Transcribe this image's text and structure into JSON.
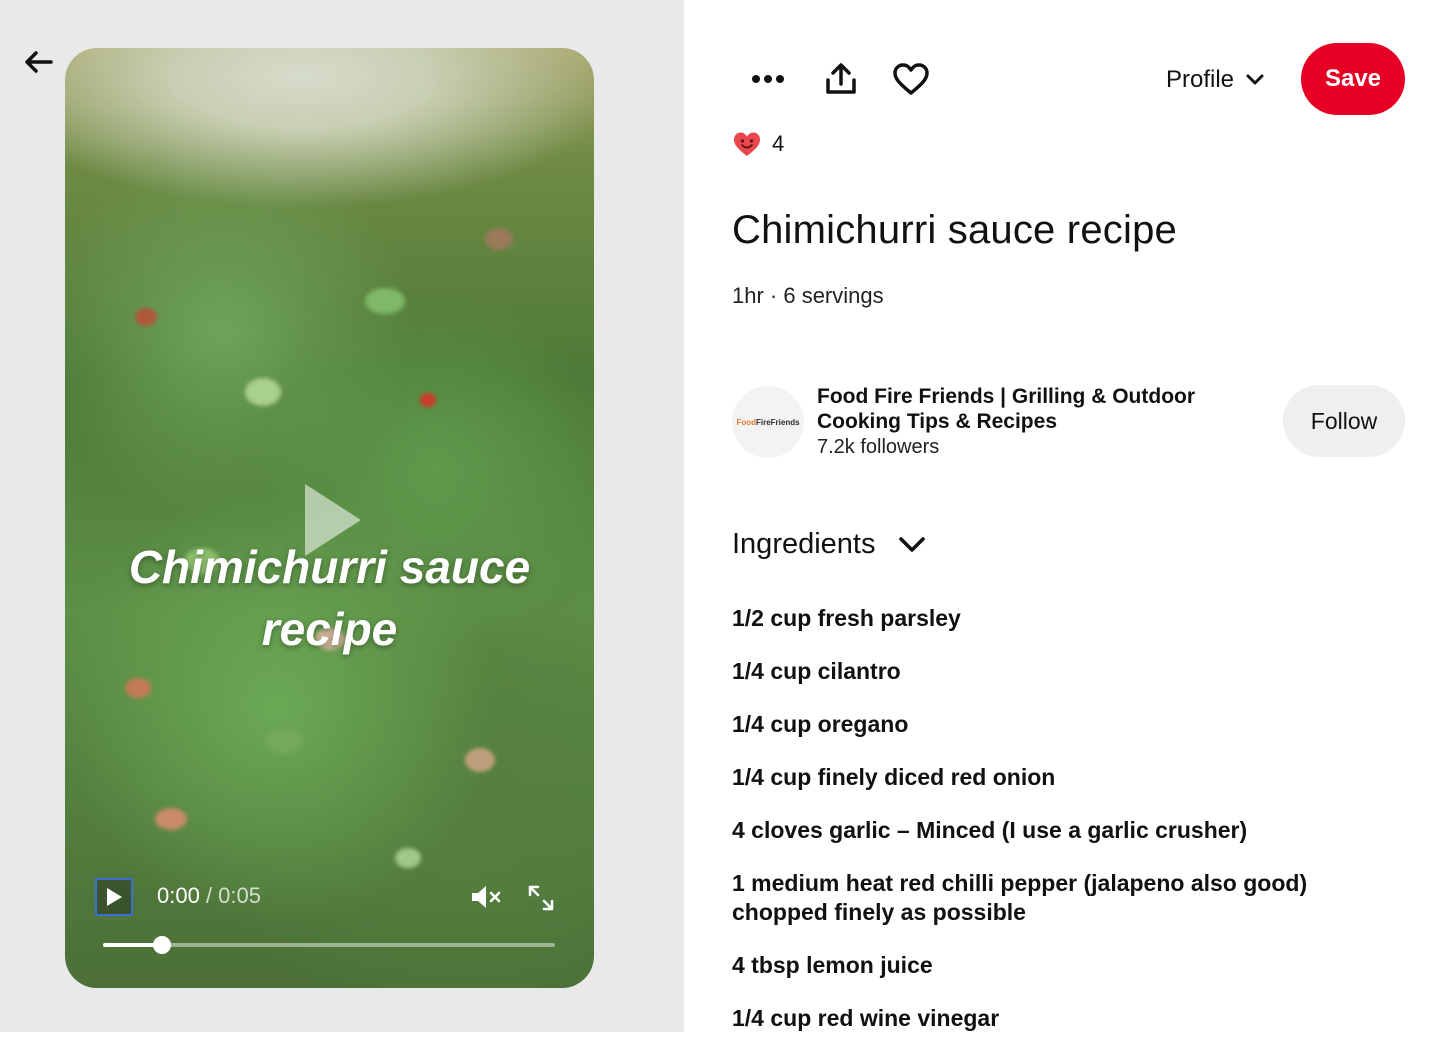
{
  "player": {
    "title_line1": "Chimichurri sauce",
    "title_line2": "recipe",
    "current_time": "0:00",
    "separator": " / ",
    "duration": "0:05",
    "progress_fraction": 0.13
  },
  "toolbar": {
    "profile_label": "Profile",
    "save_label": "Save"
  },
  "reactions": {
    "count": "4"
  },
  "pin": {
    "title": "Chimichurri sauce recipe",
    "meta": "1hr · 6 servings"
  },
  "creator": {
    "avatar_text_1": "Food",
    "avatar_text_2": "FireFriends",
    "name": "Food Fire Friends | Grilling & Outdoor Cooking Tips & Recipes",
    "followers": "7.2k followers",
    "follow_label": "Follow"
  },
  "ingredients": {
    "heading": "Ingredients",
    "items": [
      "1/2 cup fresh parsley",
      "1/4 cup cilantro",
      "1/4 cup oregano",
      "1/4 cup finely diced red onion",
      "4 cloves garlic – Minced (I use a garlic crusher)",
      "1 medium heat red chilli pepper (jalapeno also good) chopped finely as possible",
      "4 tbsp lemon juice",
      "1/4 cup red wine vinegar"
    ]
  },
  "icons": [
    "back-arrow-icon",
    "play-icon",
    "mute-icon",
    "expand-icon",
    "more-icon",
    "share-icon",
    "heart-icon",
    "chevron-down-icon",
    "heart-reaction-icon"
  ],
  "colors": {
    "save_red": "#e60023",
    "follow_gray": "#efefef",
    "left_bg": "#e9e9e9",
    "reaction_red": "#e9474c"
  }
}
